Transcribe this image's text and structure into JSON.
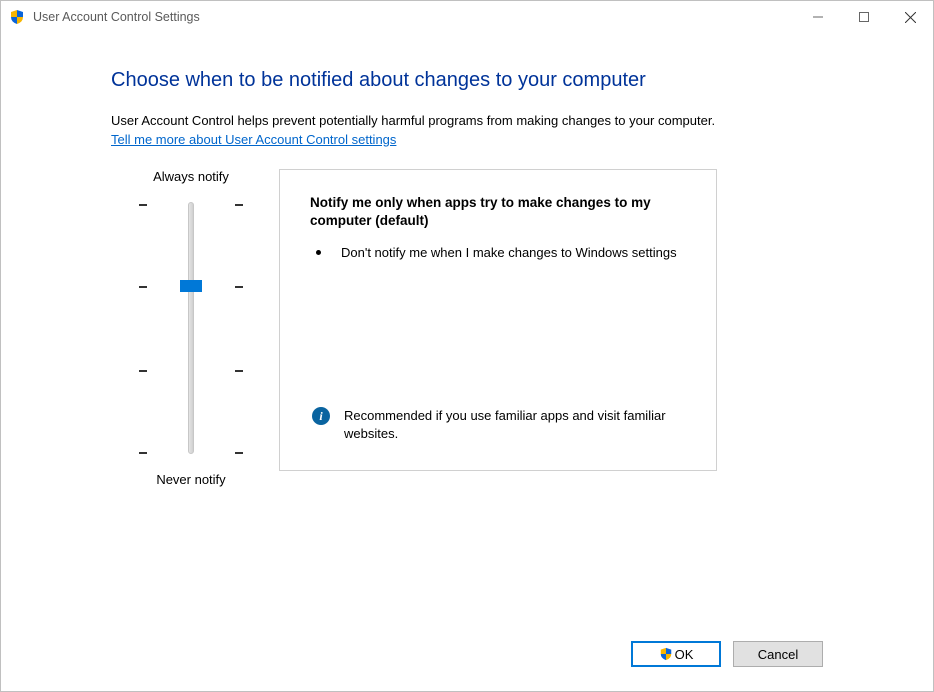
{
  "window": {
    "title": "User Account Control Settings"
  },
  "heading": "Choose when to be notified about changes to your computer",
  "description": "User Account Control helps prevent potentially harmful programs from making changes to your computer.",
  "more_link": "Tell me more about User Account Control settings",
  "slider": {
    "top_label": "Always notify",
    "bottom_label": "Never notify",
    "levels": 4,
    "current_level": 1
  },
  "detail": {
    "title": "Notify me only when apps try to make changes to my computer (default)",
    "bullets": [
      "Don't notify me when I make changes to Windows settings"
    ],
    "recommendation": "Recommended if you use familiar apps and visit familiar websites."
  },
  "buttons": {
    "ok": "OK",
    "cancel": "Cancel"
  }
}
